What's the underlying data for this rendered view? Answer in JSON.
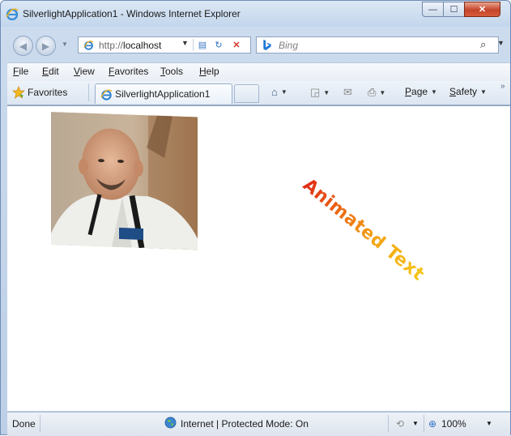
{
  "window": {
    "title": "SilverlightApplication1 - Windows Internet Explorer",
    "min_glyph": "—",
    "max_glyph": "☐",
    "close_glyph": "✕"
  },
  "address": {
    "url_scheme": "http://",
    "url_host": "localhost",
    "dropdown": "▼"
  },
  "search": {
    "placeholder": "Bing",
    "go_glyph": "⌕",
    "dropdown": "▼"
  },
  "menu": {
    "items": [
      {
        "label": "File",
        "key": "F",
        "rest": "ile"
      },
      {
        "label": "Edit",
        "key": "E",
        "rest": "dit"
      },
      {
        "label": "View",
        "key": "V",
        "rest": "iew"
      },
      {
        "label": "Favorites",
        "key": "F",
        "rest": "avorites"
      },
      {
        "label": "Tools",
        "key": "T",
        "rest": "ools"
      },
      {
        "label": "Help",
        "key": "H",
        "rest": "elp"
      }
    ]
  },
  "favorites_bar": {
    "favorites_label": "Favorites",
    "tab_label": "SilverlightApplication1",
    "page_label_key": "P",
    "page_label_rest": "age",
    "safety_label_key": "S",
    "safety_label_rest": "afety",
    "overflow": "»"
  },
  "content": {
    "animated_text": "Animated Text"
  },
  "status": {
    "left": "Done",
    "zone": "Internet | Protected Mode: On",
    "zoom": "100%"
  },
  "colors": {
    "frame": "#c3d6ec",
    "accent_close": "#c4452a",
    "text_gradient_start": "#e02a17",
    "text_gradient_end": "#f5c61a"
  }
}
